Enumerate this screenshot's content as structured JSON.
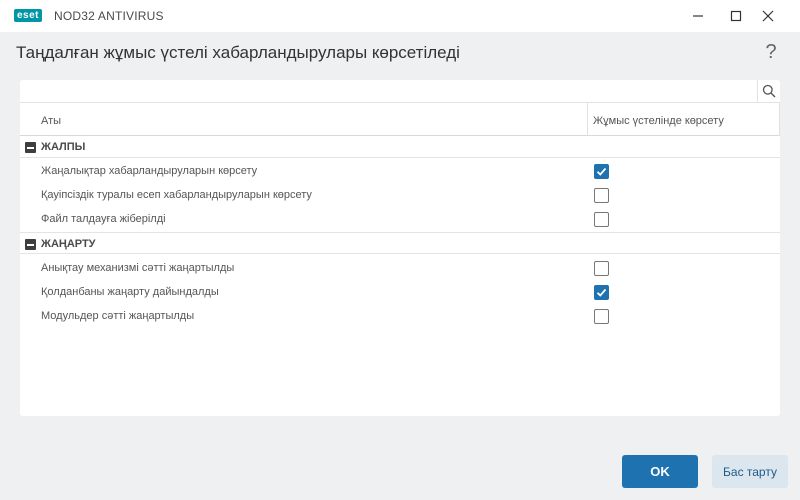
{
  "window": {
    "logo_text": "eset",
    "app_title": "NOD32 ANTIVIRUS",
    "minimize_icon": "minimize-icon",
    "maximize_icon": "maximize-icon",
    "close_icon": "close-icon"
  },
  "header": {
    "title": "Таңдалған жұмыс үстелі хабарландырулары көрсетіледі",
    "help": "?"
  },
  "search": {
    "placeholder": "",
    "value": "",
    "icon": "search-icon"
  },
  "table": {
    "columns": {
      "name": "Аты",
      "desktop": "Жұмыс үстелінде көрсету"
    },
    "groups": [
      {
        "label": "ЖАЛПЫ",
        "items": [
          {
            "label": "Жаңалықтар хабарландыруларын көрсету",
            "checked": true
          },
          {
            "label": "Қауіпсіздік туралы есеп хабарландыруларын көрсету",
            "checked": false
          },
          {
            "label": "Файл талдауға жіберілді",
            "checked": false
          }
        ]
      },
      {
        "label": "ЖАҢАРТУ",
        "items": [
          {
            "label": "Анықтау механизмі сәтті жаңартылды",
            "checked": false
          },
          {
            "label": "Қолданбаны жаңарту дайындалды",
            "checked": true
          },
          {
            "label": "Модульдер сәтті жаңартылды",
            "checked": false
          }
        ]
      }
    ]
  },
  "footer": {
    "ok_label": "OK",
    "cancel_label": "Бас тарту"
  },
  "colors": {
    "accent": "#1e72b0",
    "brand": "#0096a5",
    "background": "#eef0f2"
  }
}
